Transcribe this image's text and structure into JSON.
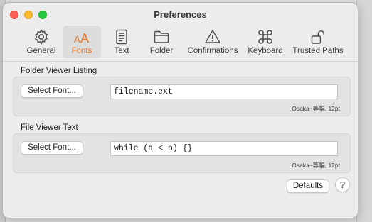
{
  "window": {
    "title": "Preferences"
  },
  "toolbar": {
    "tabs": [
      {
        "label": "General",
        "icon": "gear-icon"
      },
      {
        "label": "Fonts",
        "icon": "fonts-icon",
        "active": true
      },
      {
        "label": "Text",
        "icon": "text-document-icon"
      },
      {
        "label": "Folder",
        "icon": "folder-icon"
      },
      {
        "label": "Confirmations",
        "icon": "warning-icon"
      },
      {
        "label": "Keyboard",
        "icon": "command-key-icon"
      },
      {
        "label": "Trusted Paths",
        "icon": "lock-icon"
      }
    ]
  },
  "folder_viewer": {
    "section_title": "Folder Viewer Listing",
    "button_label": "Select Font...",
    "sample_text": "filename.ext",
    "font_info": "Osaka−等幅, 12pt"
  },
  "file_viewer": {
    "section_title": "File Viewer Text",
    "button_label": "Select Font...",
    "sample_text": "while (a < b) {}",
    "font_info": "Osaka−等幅, 12pt"
  },
  "footer": {
    "defaults_label": "Defaults",
    "help_label": "?"
  },
  "colors": {
    "accent": "#e8772e",
    "window_bg": "#ececec",
    "group_bg": "#e3e3e3"
  }
}
